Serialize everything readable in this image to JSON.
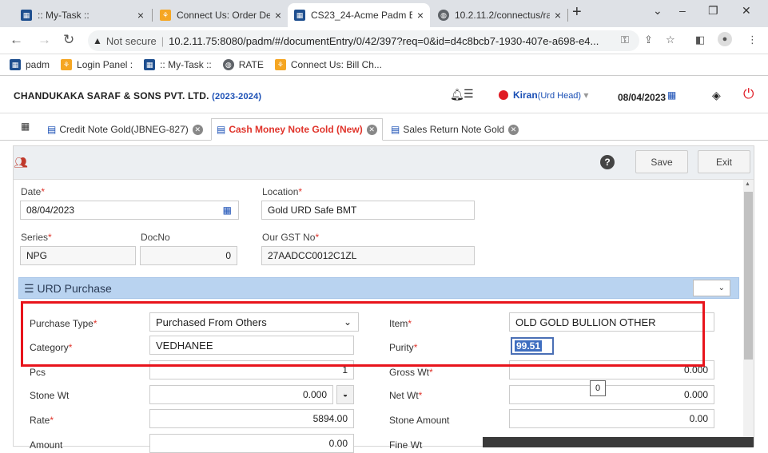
{
  "browser": {
    "tabs": [
      {
        "title": ":: My-Task ::"
      },
      {
        "title": "Connect Us: Order Det"
      },
      {
        "title": "CS23_24-Acme Padm E"
      },
      {
        "title": "10.2.11.2/connectus/ra"
      }
    ],
    "address": {
      "security": "Not secure",
      "url": "10.2.11.75:8080/padm/#/documentEntry/0/42/397?req=0&id=d4c8bcb7-1930-407e-a698-e4..."
    },
    "bookmarks": [
      {
        "label": "padm"
      },
      {
        "label": "Login Panel :"
      },
      {
        "label": ":: My-Task ::"
      },
      {
        "label": "RATE"
      },
      {
        "label": "Connect Us: Bill Ch..."
      }
    ]
  },
  "header": {
    "company": "CHANDUKAKA SARAF & SONS PVT. LTD.",
    "year": "(2023-2024)",
    "user_name": "Kiran",
    "user_role": "(Urd Head)",
    "date": "08/04/2023"
  },
  "doc_tabs": [
    {
      "label": "Credit Note Gold(JBNEG-827)"
    },
    {
      "label": "Cash Money Note Gold (New)"
    },
    {
      "label": "Sales Return Note Gold"
    }
  ],
  "toolbar": {
    "save": "Save",
    "exit": "Exit",
    "help": "?"
  },
  "form": {
    "date_label": "Date",
    "date_value": "08/04/2023",
    "location_label": "Location",
    "location_value": "Gold URD Safe BMT",
    "series_label": "Series",
    "series_value": "NPG",
    "docno_label": "DocNo",
    "docno_value": "0",
    "gst_label": "Our GST No",
    "gst_value": "27AADCC0012C1ZL"
  },
  "urd": {
    "title": "URD Purchase",
    "purchase_type_label": "Purchase Type",
    "purchase_type_value": "Purchased From Others",
    "category_label": "Category",
    "category_value": "VEDHANEE",
    "item_label": "Item",
    "item_value": "OLD GOLD BULLION OTHER",
    "purity_label": "Purity",
    "purity_value": "99.51",
    "pcs_label": "Pcs",
    "pcs_value": "1",
    "gross_wt_label": "Gross Wt",
    "gross_wt_value": "0.000",
    "stone_wt_label": "Stone Wt",
    "stone_wt_value": "0.000",
    "net_wt_label": "Net Wt",
    "net_wt_value": "0.000",
    "rate_label": "Rate",
    "rate_value": "5894.00",
    "stone_amount_label": "Stone Amount",
    "stone_amount_value": "0.00",
    "amount_label": "Amount",
    "amount_value": "0.00",
    "fine_wt_label": "Fine Wt",
    "tooltip_value": "0"
  },
  "colors": {
    "accent": "#1a4fb5",
    "active_tab": "#e0342b",
    "highlight_box": "#e8141c",
    "section_bar": "#b9d3f0"
  }
}
